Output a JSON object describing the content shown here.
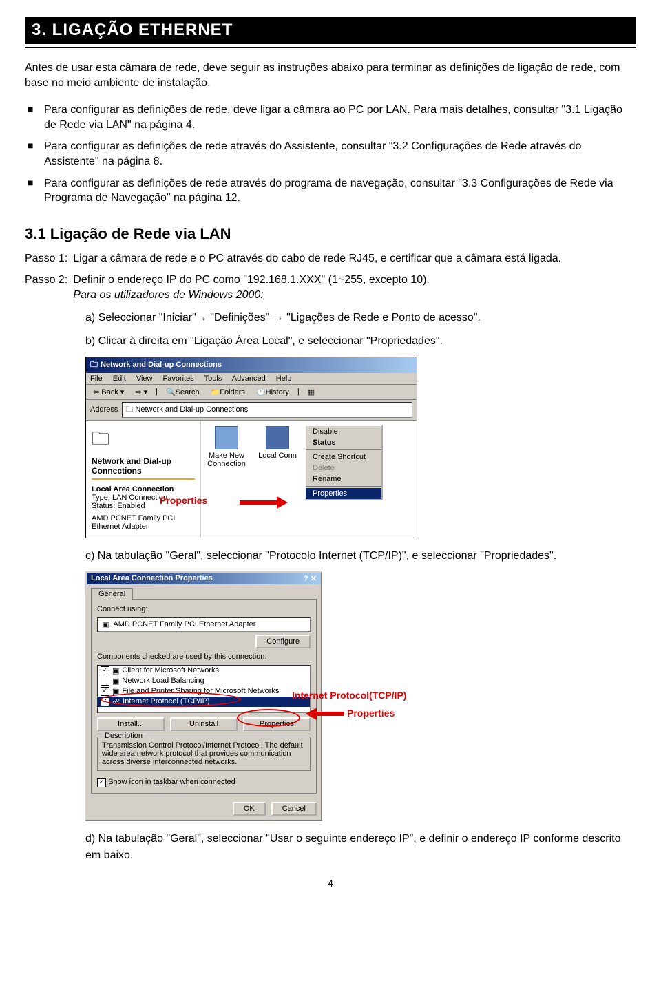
{
  "title": "3. LIGAÇÃO ETHERNET",
  "intro": "Antes de usar esta câmara de rede, deve seguir as instruções abaixo para terminar as definições de ligação de rede, com base no meio ambiente de instalação.",
  "bullets": [
    "Para configurar as definições de rede, deve ligar a câmara ao PC por LAN. Para mais detalhes, consultar \"3.1 Ligação de Rede via LAN\" na página 4.",
    "Para configurar as definições de rede através do Assistente, consultar \"3.2 Configurações de Rede através do Assistente\" na página 8.",
    "Para configurar as definições de rede através do programa de navegação, consultar \"3.3 Configurações de Rede via Programa de Navegação\" na página 12."
  ],
  "section_heading": "3.1 Ligação de Rede via LAN",
  "steps": {
    "s1_label": "Passo 1:",
    "s1_body": "Ligar a câmara de rede e o PC através do cabo de rede RJ45, e certificar que a câmara está ligada.",
    "s2_label": "Passo 2:",
    "s2_body_line1": "Definir o endereço IP do PC como \"192.168.1.XXX\" (1~255, excepto 10).",
    "s2_underline": "Para os utilizadores de Windows 2000:",
    "s2_a": "a)  Seleccionar \"Iniciar\"→ \"Definições\" → \"Ligações de Rede e Ponto de acesso\".",
    "s2_b": "b)  Clicar à direita em \"Ligação Área Local\", e seleccionar \"Propriedades\".",
    "s2_c": "c)  Na tabulação \"Geral\", seleccionar \"Protocolo Internet (TCP/IP)\", e seleccionar \"Propriedades\".",
    "s2_d": "d)  Na tabulação \"Geral\", seleccionar \"Usar o seguinte endereço IP\", e definir o endereço IP conforme descrito em baixo."
  },
  "shot1": {
    "wintitle": "Network and Dial-up Connections",
    "menus": [
      "File",
      "Edit",
      "View",
      "Favorites",
      "Tools",
      "Advanced",
      "Help"
    ],
    "tool_back": "Back",
    "tool_search": "Search",
    "tool_folders": "Folders",
    "tool_history": "History",
    "addr_label": "Address",
    "addr_value": "Network and Dial-up Connections",
    "left_header": "Network and Dial-up Connections",
    "left_lac": "Local Area Connection",
    "left_type": "Type: LAN Connection",
    "left_status": "Status: Enabled",
    "left_adapter": "AMD PCNET Family PCI Ethernet Adapter",
    "icon1": "Make New Connection",
    "icon2": "Local Conn",
    "ctx": {
      "disable": "Disable",
      "status": "Status",
      "create": "Create Shortcut",
      "delete": "Delete",
      "rename": "Rename",
      "properties": "Properties"
    },
    "annot": "Properties"
  },
  "shot2": {
    "dlgtitle": "Local Area Connection Properties",
    "tab": "General",
    "connect_using": "Connect using:",
    "adapter": "AMD PCNET Family PCI Ethernet Adapter",
    "configure": "Configure",
    "components_label": "Components checked are used by this connection:",
    "rows": [
      {
        "checked": true,
        "label": "Client for Microsoft Networks"
      },
      {
        "checked": false,
        "label": "Network Load Balancing"
      },
      {
        "checked": true,
        "label": "File and Printer Sharing for Microsoft Networks"
      },
      {
        "checked": true,
        "label": "Internet Protocol (TCP/IP)",
        "selected": true
      }
    ],
    "install": "Install...",
    "uninstall": "Uninstall",
    "properties": "Properties",
    "desc_legend": "Description",
    "desc_text": "Transmission Control Protocol/Internet Protocol. The default wide area network protocol that provides communication across diverse interconnected networks.",
    "show_icon": "Show icon in taskbar when connected",
    "ok": "OK",
    "cancel": "Cancel",
    "annot_tcpip": "Internet Protocol(TCP/IP)",
    "annot_props": "Properties"
  },
  "page_number": "4"
}
